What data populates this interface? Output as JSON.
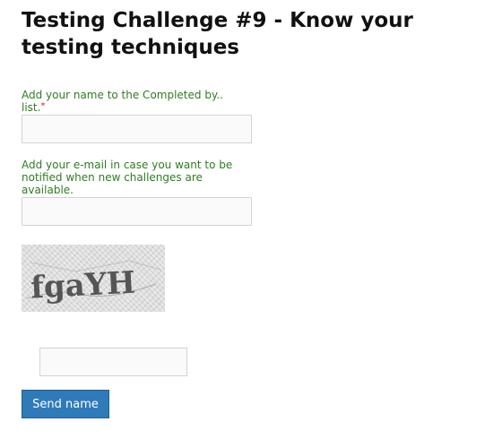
{
  "page": {
    "title": "Testing Challenge #9 - Know your testing techniques"
  },
  "form": {
    "name_label": "Add your name to the Completed by.. list.",
    "name_required_marker": "*",
    "name_value": "",
    "email_label": "Add your e-mail in case you want to be notified when new challenges are available.",
    "email_value": "",
    "captcha_text": "fgaYH",
    "captcha_value": "",
    "submit_label": "Send name"
  },
  "colors": {
    "label": "#2e7d20",
    "required": "#cc2222",
    "button": "#2f7ab8"
  }
}
